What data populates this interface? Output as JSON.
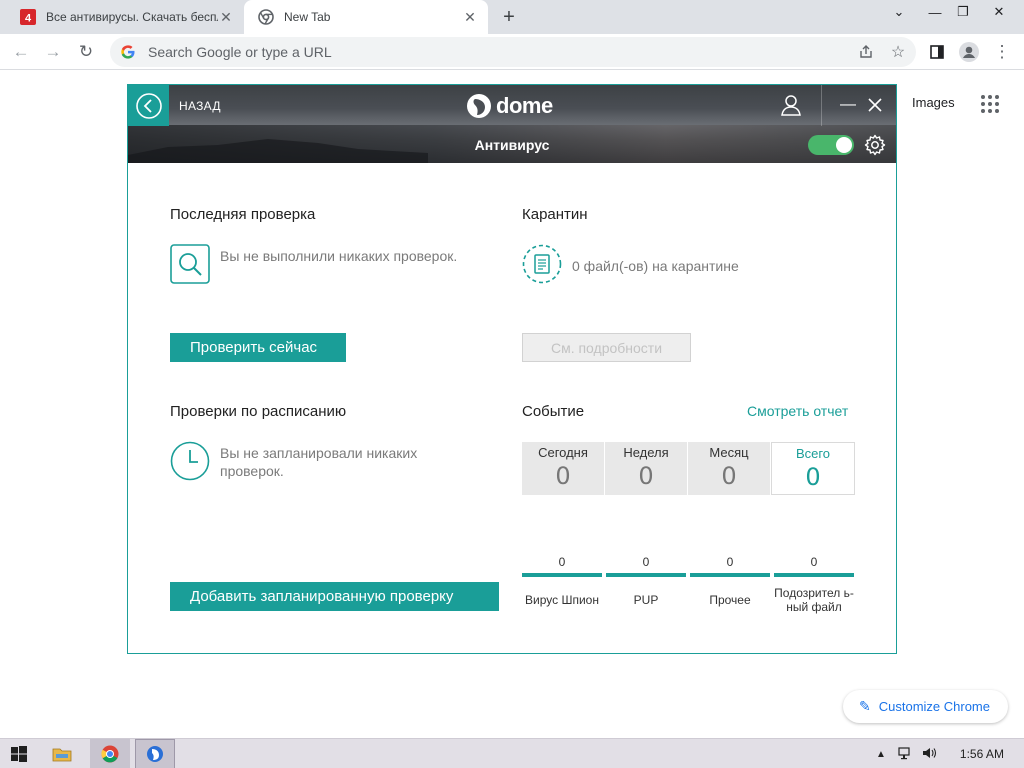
{
  "browser": {
    "tabs": [
      {
        "title": "Все антивирусы. Скачать беспл",
        "active": false
      },
      {
        "title": "New Tab",
        "active": true
      }
    ],
    "omnibox_placeholder": "Search Google or type a URL"
  },
  "ntp": {
    "images_link": "Images",
    "customize_label": "Customize Chrome"
  },
  "app": {
    "back_label": "НАЗАД",
    "brand": "dome",
    "subtitle": "Антивирус",
    "protection_enabled": true,
    "last_scan": {
      "title": "Последняя проверка",
      "message": "Вы не выполнили никаких проверок.",
      "button": "Проверить сейчас"
    },
    "quarantine": {
      "title": "Карантин",
      "message": "0 файл(-ов) на карантине",
      "button": "См. подробности"
    },
    "scheduled": {
      "title": "Проверки по расписанию",
      "message": "Вы не запланировали никаких проверок.",
      "button": "Добавить запланированную проверку"
    },
    "events": {
      "title": "Событие",
      "report_link": "Смотреть отчет",
      "periods": [
        {
          "label": "Сегодня",
          "value": "0",
          "active": false
        },
        {
          "label": "Неделя",
          "value": "0",
          "active": false
        },
        {
          "label": "Месяц",
          "value": "0",
          "active": false
        },
        {
          "label": "Всего",
          "value": "0",
          "active": true
        }
      ],
      "categories": [
        {
          "label": "Вирус Шпион",
          "value": "0"
        },
        {
          "label": "PUP",
          "value": "0"
        },
        {
          "label": "Прочее",
          "value": "0"
        },
        {
          "label": "Подозрител ь- ный файл",
          "value": "0"
        }
      ]
    },
    "accent_color": "#1a9e98"
  },
  "taskbar": {
    "clock": "1:56 AM"
  }
}
